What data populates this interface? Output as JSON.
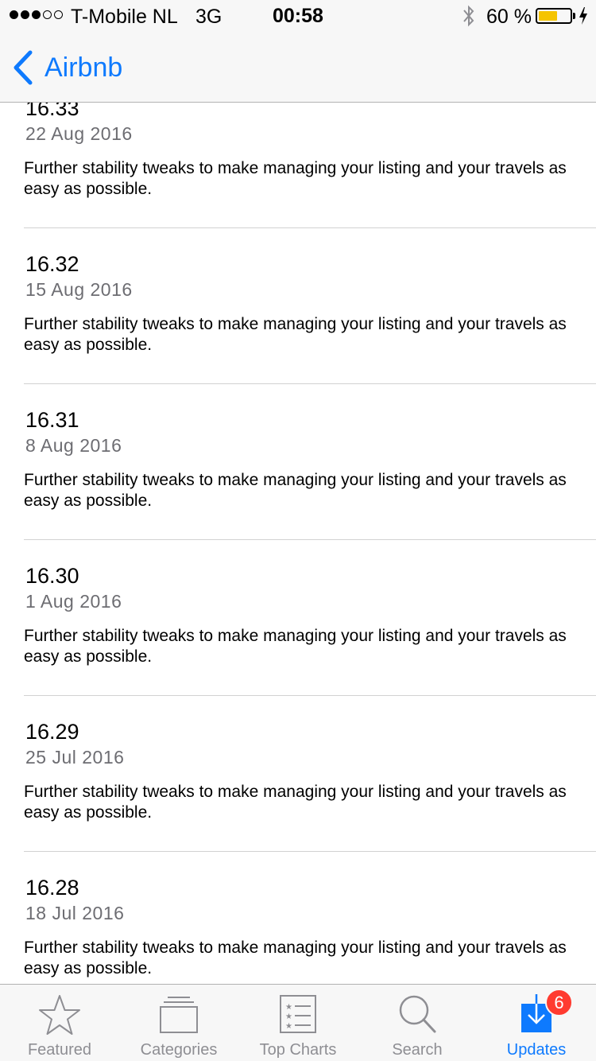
{
  "status_bar": {
    "carrier": "T-Mobile NL",
    "network": "3G",
    "time": "00:58",
    "battery_percent": "60 %",
    "battery_level": 0.6,
    "signal_bars": 3,
    "signal_max": 5,
    "battery_color": "#f5c400"
  },
  "nav": {
    "back_label": "Airbnb",
    "accent_color": "#0e7afe"
  },
  "versions": [
    {
      "version": "16.33",
      "date": "22 Aug 2016",
      "notes": "Further stability tweaks to make managing your listing and your travels as easy as possible."
    },
    {
      "version": "16.32",
      "date": "15 Aug 2016",
      "notes": "Further stability tweaks to make managing your listing and your travels as easy as possible."
    },
    {
      "version": "16.31",
      "date": "8 Aug 2016",
      "notes": "Further stability tweaks to make managing your listing and your travels as easy as possible."
    },
    {
      "version": "16.30",
      "date": "1 Aug 2016",
      "notes": "Further stability tweaks to make managing your listing and your travels as easy as possible."
    },
    {
      "version": "16.29",
      "date": "25 Jul 2016",
      "notes": "Further stability tweaks to make managing your listing and your travels as easy as possible."
    },
    {
      "version": "16.28",
      "date": "18 Jul 2016",
      "notes": "Further stability tweaks to make managing your listing and your travels as easy as possible."
    }
  ],
  "tab_bar": {
    "tabs": [
      {
        "label": "Featured",
        "icon": "star-icon",
        "active": false
      },
      {
        "label": "Categories",
        "icon": "stacked-squares-icon",
        "active": false
      },
      {
        "label": "Top Charts",
        "icon": "list-icon",
        "active": false
      },
      {
        "label": "Search",
        "icon": "search-icon",
        "active": false
      },
      {
        "label": "Updates",
        "icon": "download-icon",
        "active": true
      }
    ],
    "updates_badge": "6",
    "badge_color": "#ff3b30"
  }
}
